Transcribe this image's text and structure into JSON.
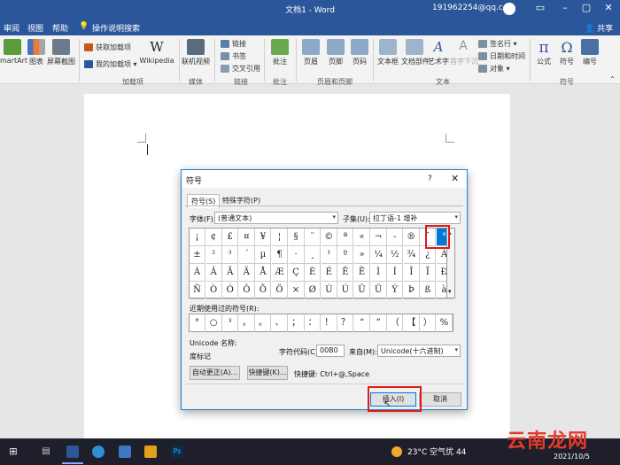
{
  "app": {
    "title": "文档1 - Word",
    "account": "191962254@qq.com"
  },
  "colors": {
    "brand": "#2b579a",
    "accent": "#0078d7",
    "highlight": "#e0191b"
  },
  "menu": {
    "tabs": [
      "审阅",
      "视图",
      "帮助"
    ],
    "tell_me": "操作说明搜索",
    "share": "共享"
  },
  "ribbon": {
    "smartart": "martArt",
    "chart": "图表",
    "screenshot": "屏幕截图",
    "get_addins": "获取加载项",
    "my_addins": "我的加载项",
    "wikipedia": "Wikipedia",
    "online_video": "联机视频",
    "link": "链接",
    "bookmark": "书签",
    "cross_ref": "交叉引用",
    "comment": "批注",
    "header": "页眉",
    "footer": "页脚",
    "page_number": "页码",
    "textbox": "文本框",
    "quick_parts": "文档部件",
    "wordart": "艺术字",
    "drop_cap": "首字下沉",
    "signature": "签名行",
    "datetime": "日期和时间",
    "object": "对象",
    "equation": "公式",
    "symbol": "符号",
    "numbering": "编号",
    "groups": {
      "addins": "加载项",
      "media": "媒体",
      "links": "链接",
      "comments": "批注",
      "header_footer": "页眉和页脚",
      "text": "文本",
      "symbols": "符号"
    }
  },
  "dialog": {
    "title": "符号",
    "help": "?",
    "close": "✕",
    "tabs": [
      "符号(S)",
      "特殊字符(P)"
    ],
    "font_label": "字体(F):",
    "font_value": "(普通文本)",
    "subset_label": "子集(U):",
    "subset_value": "拉丁语-1 增补",
    "symbols": [
      [
        "¡",
        "¢",
        "£",
        "¤",
        "¥",
        "¦",
        "§",
        "¨",
        "©",
        "ª",
        "«",
        "¬",
        "-",
        "®",
        "¯",
        "°"
      ],
      [
        "±",
        "²",
        "³",
        "´",
        "µ",
        "¶",
        "·",
        "¸",
        "¹",
        "º",
        "»",
        "¼",
        "½",
        "¾",
        "¿",
        "À"
      ],
      [
        "Á",
        "Â",
        "Ã",
        "Ä",
        "Å",
        "Æ",
        "Ç",
        "È",
        "É",
        "Ê",
        "Ë",
        "Ì",
        "Í",
        "Î",
        "Ï",
        "Ð"
      ],
      [
        "Ñ",
        "Ò",
        "Ó",
        "Ô",
        "Õ",
        "Ö",
        "×",
        "Ø",
        "Ù",
        "Ú",
        "Û",
        "Ü",
        "Ý",
        "Þ",
        "ß",
        "à"
      ]
    ],
    "selected_symbol": "°",
    "recent_label": "近期使用过的符号(R):",
    "recent": [
      "°",
      "○",
      "³",
      "，",
      "。",
      "、",
      "；",
      "：",
      "！",
      "？",
      "“",
      "”",
      "（",
      "【",
      "）",
      "%"
    ],
    "unicode_name_label": "Unicode 名称:",
    "unicode_name": "度标记",
    "char_code_label": "字符代码(C):",
    "char_code": "00B0",
    "from_label": "来自(M):",
    "from_value": "Unicode(十六进制)",
    "autocorrect_button": "自动更正(A)...",
    "shortcut_button": "快捷键(K)...",
    "shortcut_text": "快捷键: Ctrl+@,Space",
    "insert_button": "插入(I)",
    "cancel_button": "取消"
  },
  "taskbar": {
    "weather": "23°C 空气优 44",
    "date": "2021/10/5"
  },
  "watermark": "云南龙网"
}
